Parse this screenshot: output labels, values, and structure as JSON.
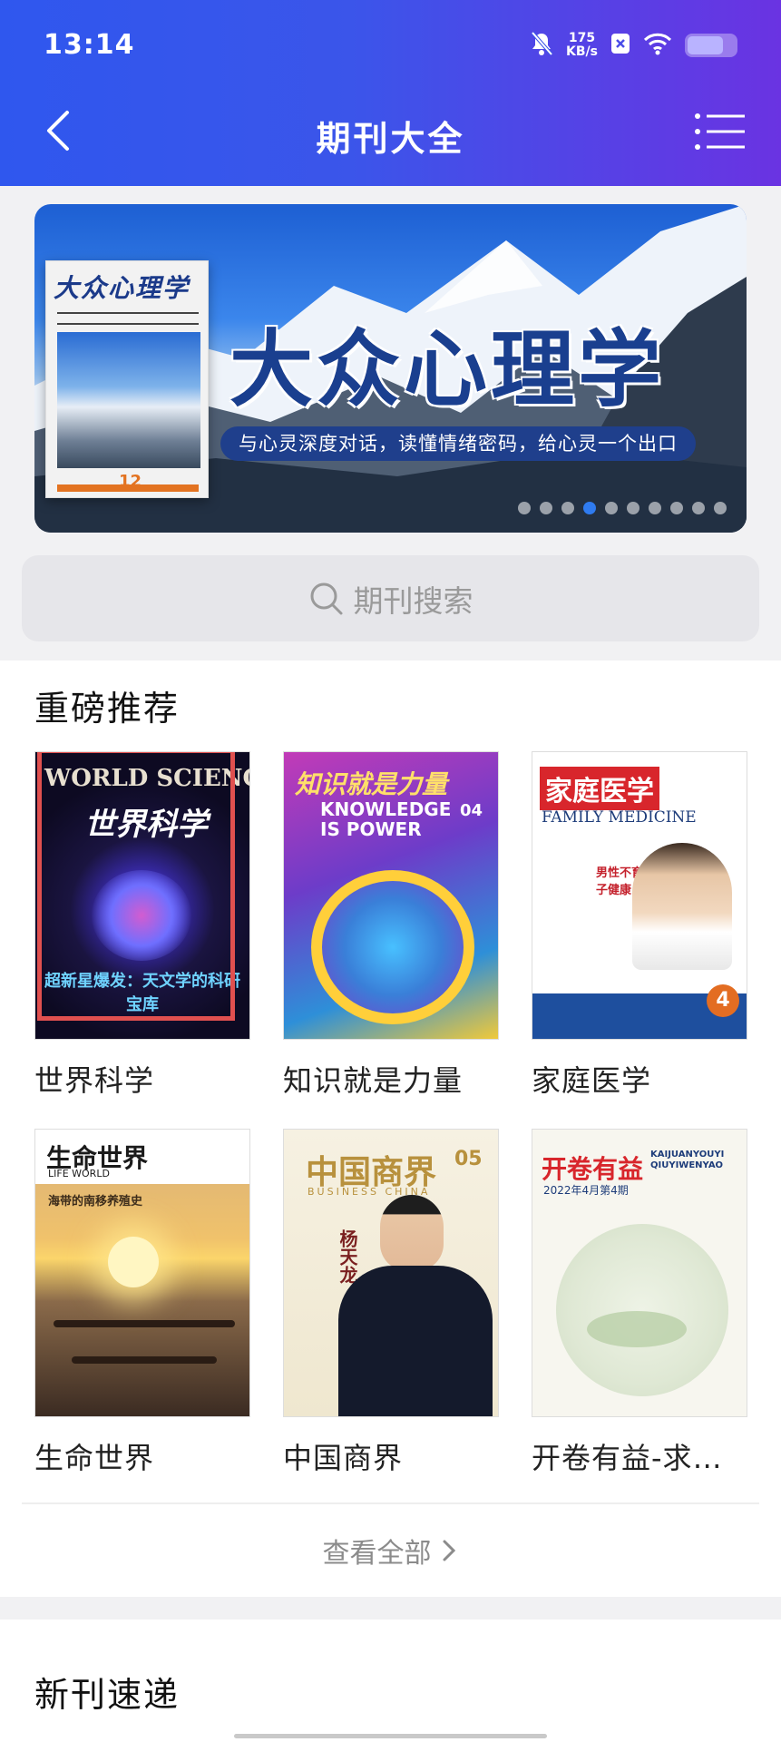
{
  "status_bar": {
    "time": "13:14",
    "net_speed_value": "175",
    "net_speed_unit": "KB/s",
    "battery_level": 0.75,
    "icons": [
      "mute-bell-icon",
      "close-box-icon",
      "wifi-icon",
      "battery-icon"
    ]
  },
  "nav": {
    "title": "期刊大全",
    "back_icon": "back-arrow-icon",
    "menu_icon": "list-menu-icon"
  },
  "banner": {
    "cover_title": "大众心理学",
    "cover_issue": "12",
    "title": "大众心理学",
    "subtitle": "与心灵深度对话，读懂情绪密码，给心灵一个出口",
    "dot_count": 10,
    "active_dot": 3
  },
  "search": {
    "placeholder": "期刊搜索",
    "icon": "search-icon"
  },
  "featured": {
    "section_title": "重磅推荐",
    "items": [
      {
        "name": "世界科学",
        "cover_title": "WORLD SCIENCE",
        "cover_cn": "世界科学",
        "cover_caption": "超新星爆发：天文学的科研宝库"
      },
      {
        "name": "知识就是力量",
        "cover_title": "知识就是力量",
        "cover_en": "KNOWLEDGE IS POWER",
        "cover_issue": "04"
      },
      {
        "name": "家庭医学",
        "cover_title": "家庭医学",
        "cover_en": "FAMILY MEDICINE",
        "cover_caption": "男性不育之精子健康",
        "cover_issue": "4"
      },
      {
        "name": "生命世界",
        "cover_title": "生命世界",
        "cover_en": "LIFE WORLD",
        "cover_caption": "海带的南移养殖史"
      },
      {
        "name": "中国商界",
        "cover_title": "中国商界",
        "cover_en": "BUSINESS CHINA",
        "cover_issue": "05",
        "cover_caption": "杨天龙"
      },
      {
        "name": "开卷有益-求医问药",
        "cover_title": "开卷有益",
        "cover_en": "KAIJUANYOUYI QIUYIWENYAO",
        "cover_caption": "2022年4月第4期"
      }
    ],
    "view_all_label": "查看全部"
  },
  "new_issues": {
    "section_title": "新刊速递"
  },
  "colors": {
    "header_start": "#2f57ee",
    "header_end": "#6a33e2",
    "banner_title": "#1a3f8f",
    "active_dot": "#2f7bf0"
  }
}
